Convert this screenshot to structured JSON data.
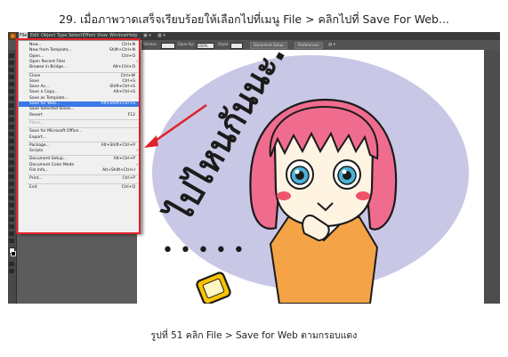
{
  "step_heading": "29. เมื่อภาพวาดเสร็จเรียบร้อยให้เลือกไปที่เมนู File > คลิกไปที่ Save For Web...",
  "caption": "รูปที่ 51 คลิก File > Save for Web ตามกรอบแดง",
  "app": {
    "logo": "Ai",
    "menubar": [
      "File",
      "Edit",
      "Object",
      "Type",
      "Select",
      "Effect",
      "View",
      "Window",
      "Help"
    ],
    "menubar_active": "File",
    "control_bar": {
      "stroke_label": "Stroke:",
      "opacity_label": "Opacity:",
      "opacity_value": "100%",
      "style_label": "Style:",
      "basic_label": "Basic",
      "document_setup": "Document Setup",
      "preferences": "Preferences"
    },
    "file_menu": [
      {
        "label": "New...",
        "shortcut": "Ctrl+N"
      },
      {
        "label": "New from Template...",
        "shortcut": "Shift+Ctrl+N"
      },
      {
        "label": "Open...",
        "shortcut": "Ctrl+O"
      },
      {
        "label": "Open Recent Files",
        "shortcut": "",
        "submenu": true
      },
      {
        "label": "Browse in Bridge...",
        "shortcut": "Alt+Ctrl+O"
      },
      {
        "separator": true
      },
      {
        "label": "Close",
        "shortcut": "Ctrl+W"
      },
      {
        "label": "Save",
        "shortcut": "Ctrl+S"
      },
      {
        "label": "Save As...",
        "shortcut": "Shift+Ctrl+S"
      },
      {
        "label": "Save a Copy...",
        "shortcut": "Alt+Ctrl+S"
      },
      {
        "label": "Save as Template...",
        "shortcut": ""
      },
      {
        "label": "Save for Web...",
        "shortcut": "Alt+Shift+Ctrl+S",
        "highlight": true
      },
      {
        "label": "Save Selected Slices...",
        "shortcut": ""
      },
      {
        "label": "Revert",
        "shortcut": "F12"
      },
      {
        "separator": true
      },
      {
        "label": "Place...",
        "shortcut": "",
        "disabled": true
      },
      {
        "separator": true
      },
      {
        "label": "Save for Microsoft Office...",
        "shortcut": ""
      },
      {
        "label": "Export...",
        "shortcut": ""
      },
      {
        "separator": true
      },
      {
        "label": "Package...",
        "shortcut": "Alt+Shift+Ctrl+P"
      },
      {
        "label": "Scripts",
        "shortcut": "",
        "submenu": true
      },
      {
        "separator": true
      },
      {
        "label": "Document Setup...",
        "shortcut": "Alt+Ctrl+P"
      },
      {
        "label": "Document Color Mode",
        "shortcut": "",
        "submenu": true
      },
      {
        "label": "File Info...",
        "shortcut": "Alt+Shift+Ctrl+I"
      },
      {
        "separator": true
      },
      {
        "label": "Print...",
        "shortcut": "Ctrl+P"
      },
      {
        "separator": true
      },
      {
        "label": "Exit",
        "shortcut": "Ctrl+Q"
      }
    ]
  },
  "artwork": {
    "text": "ไปไหนกันนะ...???",
    "dots": "• • • • •"
  },
  "colors": {
    "highlight": "#e0212b",
    "menu_highlight": "#3b78e7",
    "ellipse": "#c9c7e6",
    "hair": "#f06c8f",
    "shirt": "#f5a347"
  }
}
